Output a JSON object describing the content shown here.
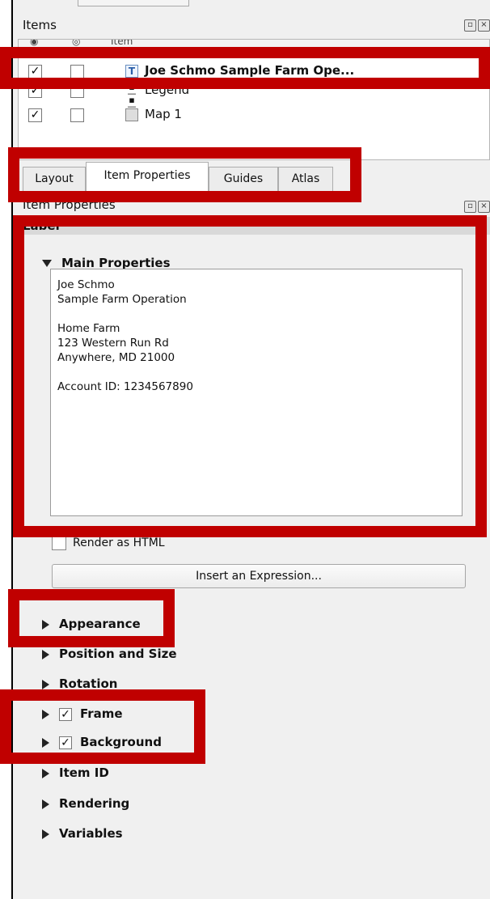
{
  "items_panel": {
    "title": "Items",
    "header_item": "Item",
    "rows": [
      {
        "label": "Joe Schmo Sample Farm Ope...",
        "visible": true,
        "locked": false,
        "icon": "label-text-icon",
        "selected": true
      },
      {
        "label": "Legend",
        "visible": true,
        "locked": false,
        "icon": "legend-icon",
        "selected": false
      },
      {
        "label": "Map 1",
        "visible": true,
        "locked": false,
        "icon": "map-icon",
        "selected": false
      }
    ]
  },
  "tabs": [
    {
      "label": "Layout",
      "active": false
    },
    {
      "label": "Item Properties",
      "active": true
    },
    {
      "label": "Guides",
      "active": false
    },
    {
      "label": "Atlas",
      "active": false
    }
  ],
  "properties_panel": {
    "title": "Item Properties",
    "item_type": "Label",
    "main_properties": {
      "title": "Main Properties",
      "expanded": true,
      "label_text": "Joe Schmo\nSample Farm Operation\n\nHome Farm\n123 Western Run Rd\nAnywhere, MD 21000\n\nAccount ID: 1234567890",
      "render_as_html_label": "Render as HTML",
      "render_as_html_checked": false,
      "insert_expression_label": "Insert an Expression..."
    },
    "sections": [
      {
        "title": "Appearance",
        "expanded": false
      },
      {
        "title": "Position and Size",
        "expanded": false
      },
      {
        "title": "Rotation",
        "expanded": false
      },
      {
        "title": "Frame",
        "expanded": false,
        "checkbox": true
      },
      {
        "title": "Background",
        "expanded": false,
        "checkbox": true
      },
      {
        "title": "Item ID",
        "expanded": false
      },
      {
        "title": "Rendering",
        "expanded": false
      },
      {
        "title": "Variables",
        "expanded": false
      }
    ]
  },
  "colors": {
    "highlight": "#c00000",
    "panel_bg": "#f0f0f0",
    "label_bar": "#d9d9d9"
  }
}
